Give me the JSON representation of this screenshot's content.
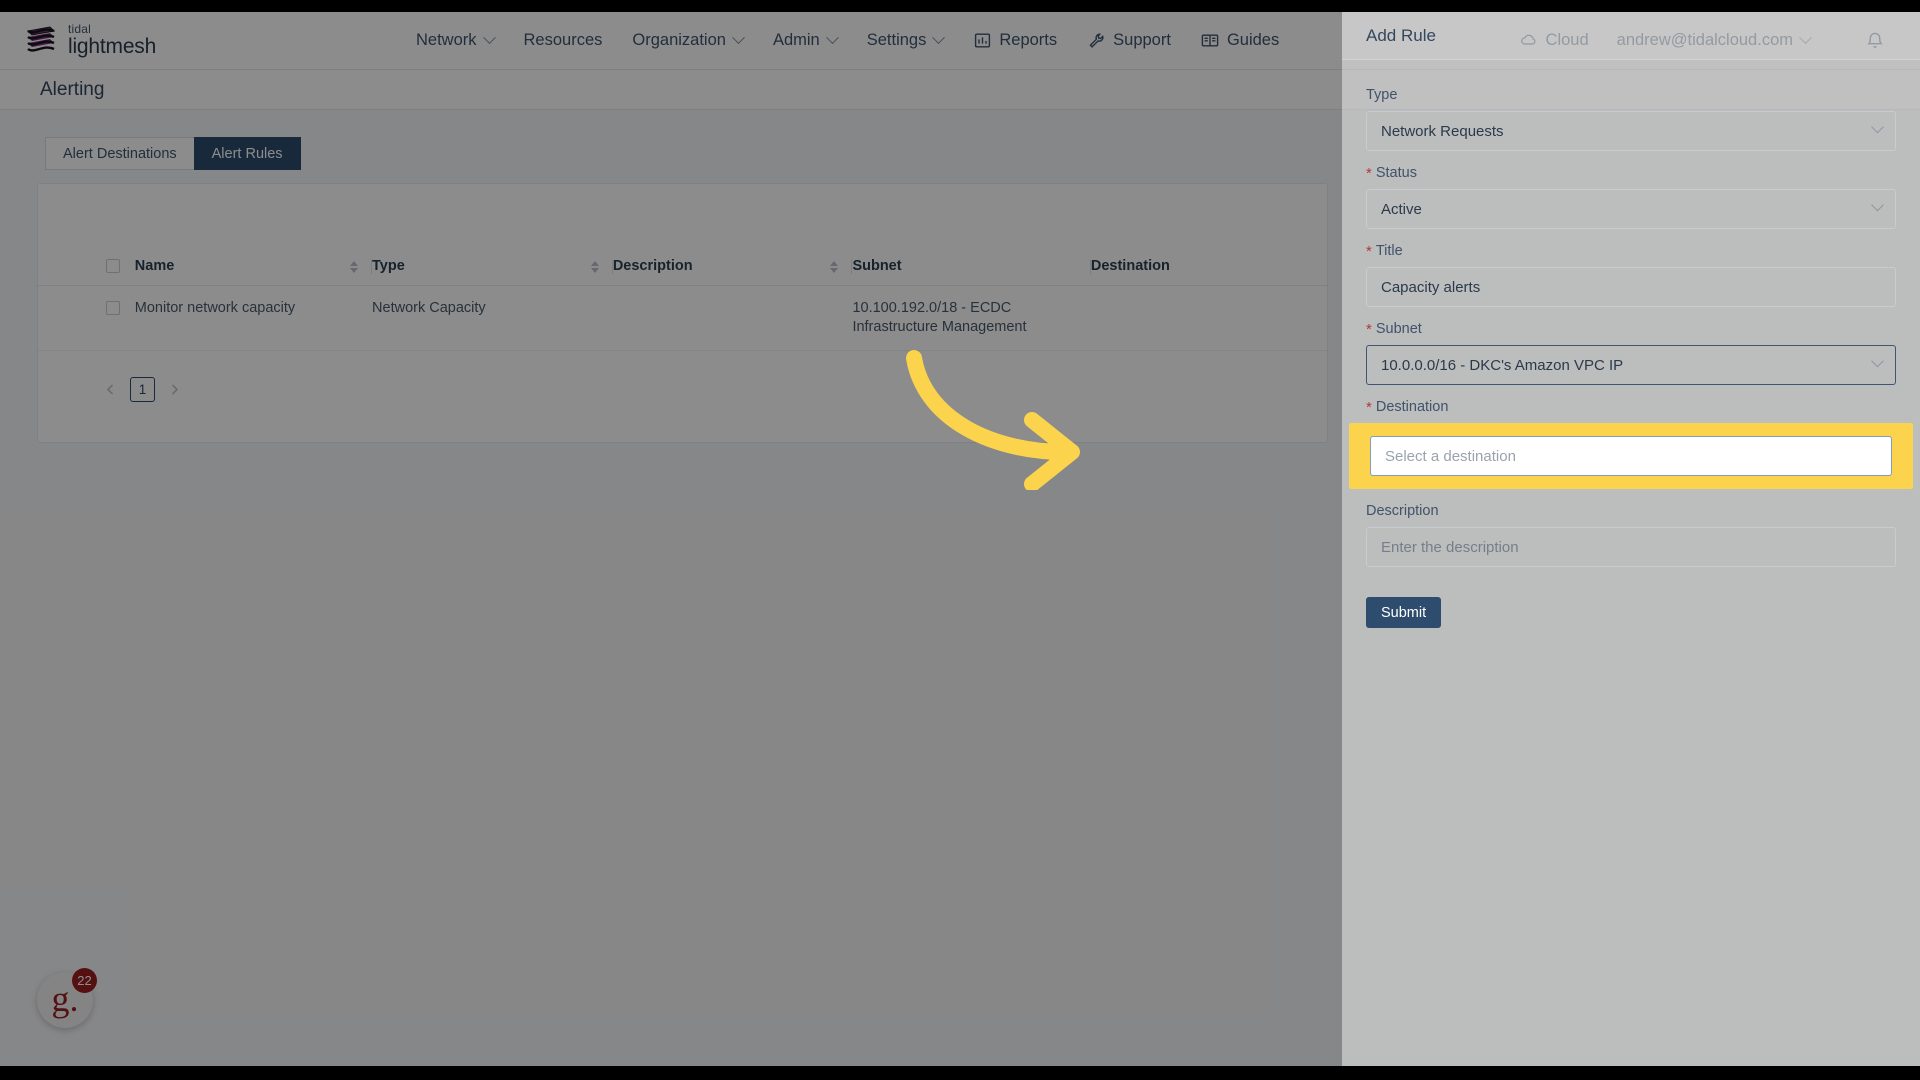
{
  "brand": {
    "top": "tidal",
    "bottom": "lightmesh",
    "mark_icon": "tidal-logo-icon"
  },
  "topnav": {
    "items": [
      {
        "label": "Network",
        "caret": true,
        "icon": ""
      },
      {
        "label": "Resources",
        "caret": false,
        "icon": ""
      },
      {
        "label": "Organization",
        "caret": true,
        "icon": ""
      },
      {
        "label": "Admin",
        "caret": true,
        "icon": ""
      },
      {
        "label": "Settings",
        "caret": true,
        "icon": ""
      },
      {
        "label": "Reports",
        "caret": false,
        "icon": "bar-chart-icon"
      },
      {
        "label": "Support",
        "caret": false,
        "icon": "wrench-icon"
      },
      {
        "label": "Guides",
        "caret": false,
        "icon": "book-icon"
      }
    ],
    "right": {
      "cloud_label": "Cloud",
      "cloud_icon": "cloud-icon",
      "account_email": "andrew@tidalcloud.com",
      "account_caret": true,
      "bell_icon": "bell-icon"
    }
  },
  "page": {
    "title": "Alerting",
    "tabs": [
      {
        "label": "Alert Destinations",
        "active": false
      },
      {
        "label": "Alert Rules",
        "active": true
      }
    ]
  },
  "table": {
    "columns": [
      {
        "label": "Name",
        "sortable": true
      },
      {
        "label": "Type",
        "sortable": true
      },
      {
        "label": "Description",
        "sortable": true
      },
      {
        "label": "Subnet",
        "sortable": false
      },
      {
        "label": "Destination",
        "sortable": false
      }
    ],
    "rows": [
      {
        "name": "Monitor network capacity",
        "type": "Network Capacity",
        "description": "",
        "subnet": "10.100.192.0/18 - ECDC Infrastructure Management",
        "destination": ""
      }
    ]
  },
  "pagination": {
    "prev_icon": "chevron-left-icon",
    "next_icon": "chevron-right-icon",
    "current_page": "1"
  },
  "guru_widget": {
    "letter": "g.",
    "count": "22"
  },
  "drawer": {
    "title": "Add Rule",
    "fields": {
      "type": {
        "label": "Type",
        "required": false,
        "value": "Network Requests",
        "control": "select"
      },
      "status": {
        "label": "Status",
        "required": true,
        "value": "Active",
        "control": "select"
      },
      "title": {
        "label": "Title",
        "required": true,
        "value": "Capacity alerts",
        "control": "input"
      },
      "subnet": {
        "label": "Subnet",
        "required": true,
        "value": "10.0.0.0/16 - DKC's Amazon VPC IP",
        "control": "select"
      },
      "destination": {
        "label": "Destination",
        "required": true,
        "value": "",
        "placeholder": "Select a destination",
        "control": "select"
      },
      "description": {
        "label": "Description",
        "required": false,
        "value": "",
        "placeholder": "Enter the description",
        "control": "input"
      }
    },
    "submit_label": "Submit"
  },
  "annotation": {
    "arrow_icon": "curved-arrow-right-icon",
    "highlight_color": "#fbd34d",
    "target": "destination-field"
  },
  "colors": {
    "brand_navy": "#2e4c6d",
    "text_navy": "#33475e",
    "required_red": "#b4373a",
    "highlight_yellow": "#fbd34d",
    "guru_red": "#9b1f22"
  }
}
